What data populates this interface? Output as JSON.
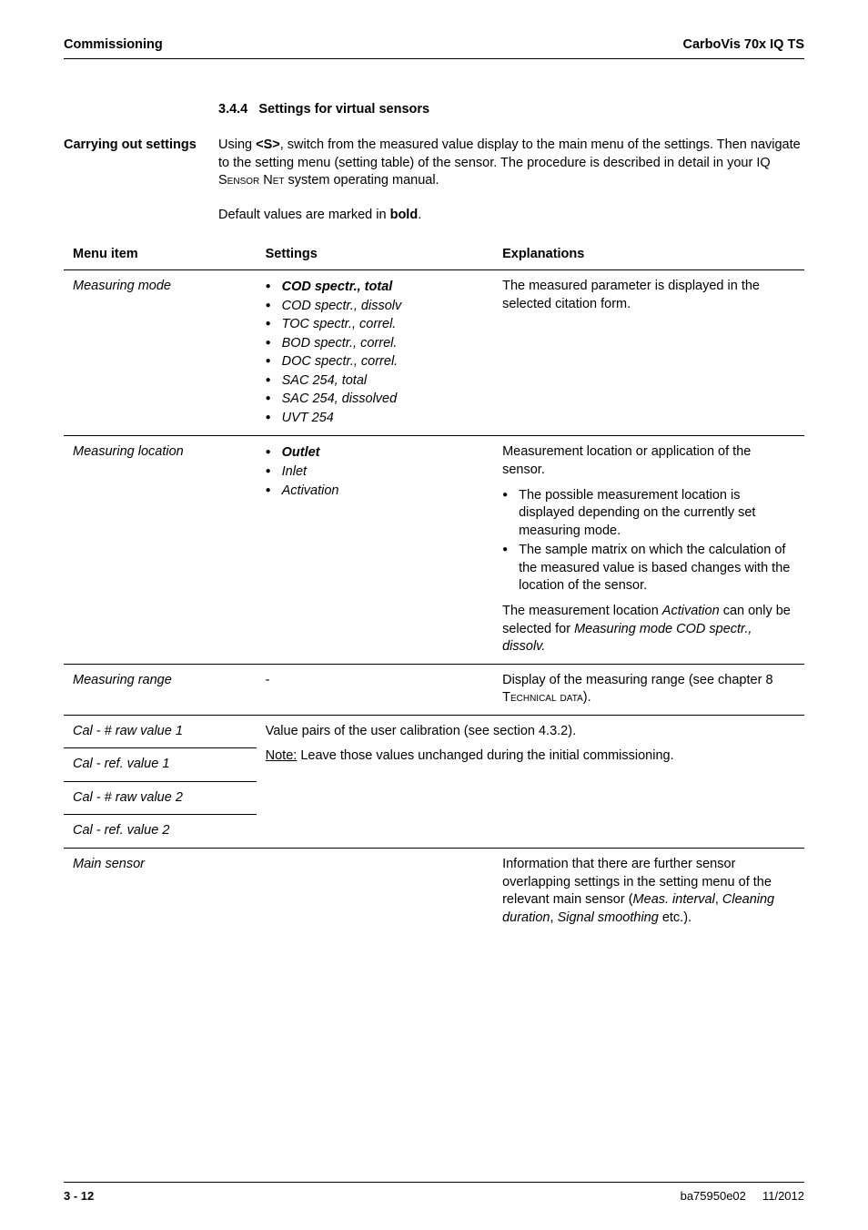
{
  "header": {
    "left": "Commissioning",
    "right": "CarboVis 70x IQ TS"
  },
  "section": {
    "number": "3.4.4",
    "title": "Settings for virtual sensors"
  },
  "sidehead": "Carrying out settings",
  "para1_a": "Using ",
  "para1_s": "<S>",
  "para1_b": ", switch from the measured value display to the main menu of the settings. Then navigate to the setting menu (setting table) of the sensor. The procedure is described in detail in your IQ S",
  "para1_sc": "ensor",
  "para1_c": " N",
  "para1_sc2": "et",
  "para1_d": " system operating manual.",
  "para2_a": "Default values are marked in ",
  "para2_b": "bold",
  "para2_c": ".",
  "table": {
    "headers": {
      "c1": "Menu item",
      "c2": "Settings",
      "c3": "Explanations"
    },
    "rows": [
      {
        "menu": "Measuring mode",
        "settings": [
          {
            "label": "COD spectr., total",
            "bold": true
          },
          {
            "label": "COD spectr., dissolv"
          },
          {
            "label": "TOC spectr., correl."
          },
          {
            "label": "BOD spectr., correl."
          },
          {
            "label": "DOC spectr., correl."
          },
          {
            "label": "SAC 254, total"
          },
          {
            "label": "SAC 254, dissolved"
          },
          {
            "label": "UVT 254"
          }
        ],
        "expl_a": "The measured parameter is displayed in the selected citation form."
      },
      {
        "menu": "Measuring location",
        "settings": [
          {
            "label": "Outlet",
            "bold": true
          },
          {
            "label": "Inlet"
          },
          {
            "label": "Activation"
          }
        ],
        "expl_intro": "Measurement location or application of the sensor.",
        "expl_b1": "The possible measurement location is displayed depending on the currently set measuring mode.",
        "expl_b2": "The sample matrix on which the calculation of the measured value is based changes with the location of the sensor.",
        "expl_tail_a": "The measurement location ",
        "expl_tail_i1": "Activation",
        "expl_tail_b": " can only be selected for ",
        "expl_tail_i2": "Measuring mode",
        "expl_tail_c": " ",
        "expl_tail_i3": "COD spectr., dissolv.",
        "expl_tail_d": ""
      },
      {
        "menu": "Measuring range",
        "settings_text": "-",
        "expl_a": "Display of the measuring range (see chapter 8 T",
        "expl_sc": "echnical data",
        "expl_b": ")."
      },
      {
        "menu": "Cal - # raw value 1",
        "span_text_a": "Value pairs of the user calibration (see section 4.3.2).",
        "span_note_u": "Note:",
        "span_note_b": " Leave those values unchanged during the initial commissioning."
      },
      {
        "menu": "Cal - ref. value 1"
      },
      {
        "menu": "Cal - # raw value 2"
      },
      {
        "menu": "Cal - ref. value 2"
      },
      {
        "menu": "Main sensor",
        "expl_a": "Information that there are further sensor overlapping settings in the setting menu of the relevant main sensor (",
        "expl_i": "Meas. interval",
        "expl_c": ", ",
        "expl_i2": "Cleaning duration",
        "expl_c2": ", ",
        "expl_i3": "Signal smoothing",
        "expl_b": " etc.)."
      }
    ]
  },
  "footer": {
    "page": "3 - 12",
    "doc": "ba75950e02",
    "date": "11/2012"
  }
}
